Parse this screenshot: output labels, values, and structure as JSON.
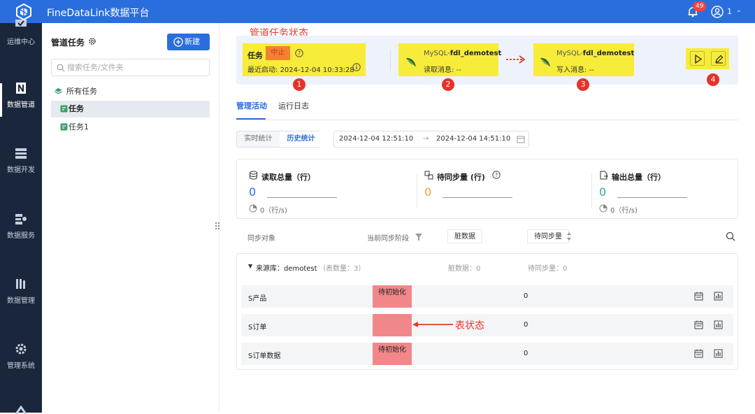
{
  "app": {
    "title": "FineDataLink数据平台",
    "notifications": "49",
    "user": "1"
  },
  "nav": [
    {
      "label": "运维中心",
      "icon": "ops-center-icon"
    },
    {
      "label": "数据管道",
      "icon": "pipeline-icon",
      "active": true
    },
    {
      "label": "数据开发",
      "icon": "dev-icon"
    },
    {
      "label": "数据服务",
      "icon": "service-icon"
    },
    {
      "label": "数据管理",
      "icon": "manage-icon"
    },
    {
      "label": "管理系统",
      "icon": "gear-icon"
    }
  ],
  "sidebar": {
    "title": "管道任务",
    "new_button": "新建",
    "search_placeholder": "搜索任务/文件夹",
    "tree": {
      "root": "所有任务",
      "items": [
        "任务",
        "任务1"
      ]
    }
  },
  "pipeline": {
    "task_label": "任务",
    "status": "中止",
    "recent_start_label": "最近启动:",
    "recent_start_time": "2024-12-04 10:33:28",
    "source": {
      "prefix": "MySQL-",
      "name": "fdl_demotest",
      "msg": "读取消息: --"
    },
    "target": {
      "prefix": "MySQL-",
      "name": "fdl_demotest",
      "msg": "写入消息: --"
    },
    "highlight_color": "#f7ec3a"
  },
  "annotations": {
    "status_caption": "管道任务状态",
    "table_caption": "表状态",
    "numbers": [
      "1",
      "2",
      "3",
      "4"
    ],
    "color": "#e03a2f"
  },
  "tabs": [
    {
      "label": "管理活动",
      "active": true
    },
    {
      "label": "运行日志"
    }
  ],
  "stats_mode": {
    "options": [
      "实时统计",
      "历史统计"
    ],
    "selected": "历史统计"
  },
  "date_range": {
    "from": "2024-12-04 12:51:10",
    "to": "2024-12-04 14:51:10"
  },
  "stats": [
    {
      "title": "读取总量（行）",
      "value": "0",
      "rate": "0（行/s)",
      "color": "#2a6ede"
    },
    {
      "title": "待同步量 (行)",
      "value": "0",
      "rate": "",
      "color": "#f29d38"
    },
    {
      "title": "输出总量（行）",
      "value": "0",
      "rate": "0（行/s)",
      "color": "#23b39a"
    }
  ],
  "table": {
    "headers": {
      "object": "同步对象",
      "stage": "当前同步阶段",
      "dirty": "脏数据",
      "pending": "待同步量"
    },
    "group": {
      "label": "来源库：demotest",
      "count": "（表数量：3）",
      "dirty": "脏数据：0",
      "pending": "待同步量：0"
    },
    "rows": [
      {
        "name": "S产品",
        "stage": "待初始化",
        "pending": "0"
      },
      {
        "name": "S订单",
        "stage": "",
        "pending": "0"
      },
      {
        "name": "S订单数据",
        "stage": "待初始化",
        "pending": "0"
      }
    ]
  }
}
